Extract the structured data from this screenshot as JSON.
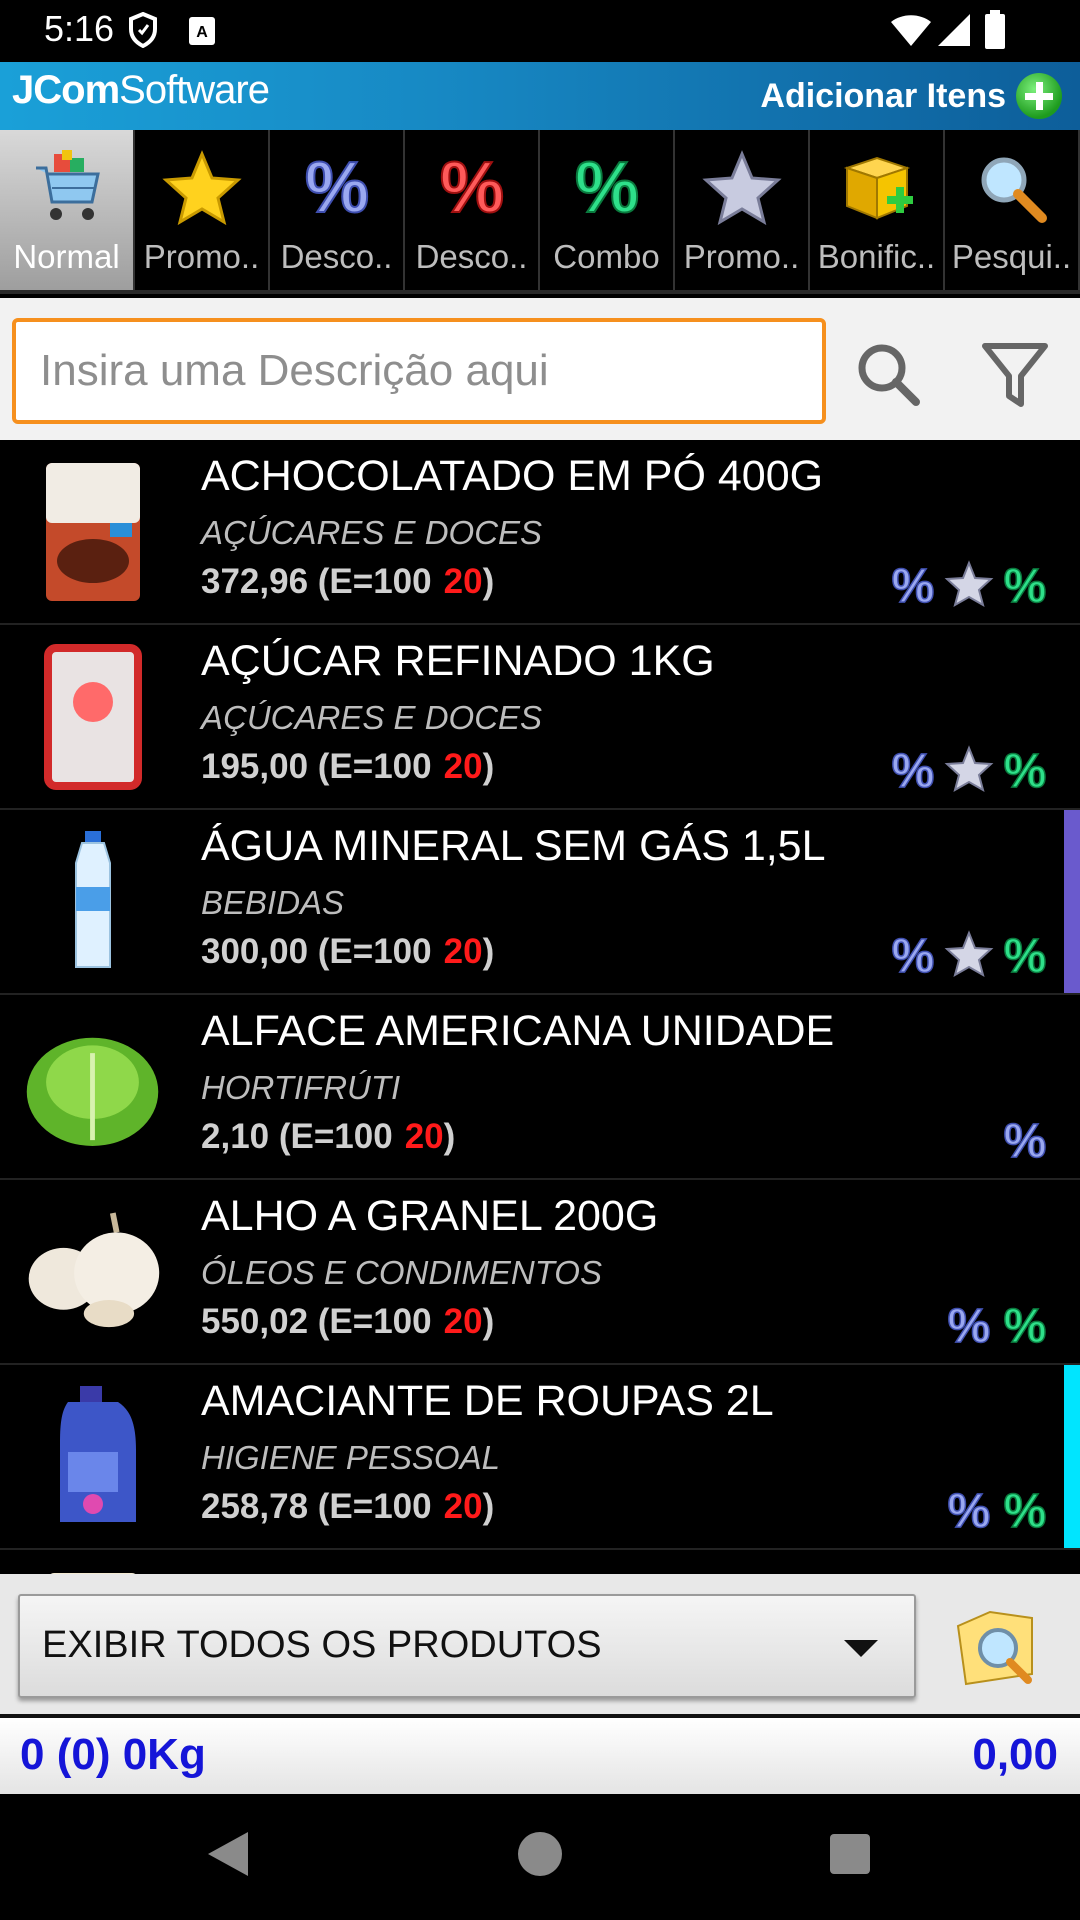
{
  "status_bar": {
    "time": "5:16"
  },
  "header": {
    "brand_bold": "JCom",
    "brand_light": "Software",
    "add_items_label": "Adicionar Itens"
  },
  "tabs": [
    {
      "label": "Normal",
      "icon": "cart-icon",
      "active": true
    },
    {
      "label": "Promo..",
      "icon": "gold-star-icon"
    },
    {
      "label": "Desco..",
      "icon": "blue-percent-icon"
    },
    {
      "label": "Desco..",
      "icon": "red-percent-icon"
    },
    {
      "label": "Combo",
      "icon": "green-percent-icon"
    },
    {
      "label": "Promo..",
      "icon": "silver-star-icon"
    },
    {
      "label": "Bonific..",
      "icon": "gift-box-icon"
    },
    {
      "label": "Pesqui..",
      "icon": "magnifier-icon"
    }
  ],
  "search": {
    "placeholder": "Insira uma Descrição aqui"
  },
  "products": [
    {
      "name": "ACHOCOLATADO EM PÓ 400G",
      "category": "AÇÚCARES E DOCES",
      "price": "372,96 (E=100",
      "stock": "20",
      "close": ")",
      "badges": [
        "blue-percent",
        "silver-star",
        "green-percent"
      ],
      "marker": ""
    },
    {
      "name": "AÇÚCAR REFINADO 1KG",
      "category": "AÇÚCARES E DOCES",
      "price": "195,00 (E=100",
      "stock": "20",
      "close": ")",
      "badges": [
        "blue-percent",
        "silver-star",
        "green-percent"
      ],
      "marker": ""
    },
    {
      "name": "ÁGUA MINERAL SEM GÁS 1,5L",
      "category": "BEBIDAS",
      "price": "300,00 (E=100",
      "stock": "20",
      "close": ")",
      "badges": [
        "blue-percent",
        "silver-star",
        "green-percent"
      ],
      "marker": "#6a5acd"
    },
    {
      "name": "ALFACE AMERICANA UNIDADE",
      "category": "HORTIFRÚTI",
      "price": "2,10 (E=100",
      "stock": "20",
      "close": ")",
      "badges": [
        "blue-percent"
      ],
      "marker": ""
    },
    {
      "name": "ALHO A GRANEL 200G",
      "category": "ÓLEOS E CONDIMENTOS",
      "price": "550,02 (E=100",
      "stock": "20",
      "close": ")",
      "badges": [
        "blue-percent",
        "green-percent"
      ],
      "marker": ""
    },
    {
      "name": "AMACIANTE DE ROUPAS 2L",
      "category": "HIGIENE PESSOAL",
      "price": "258,78 (E=100",
      "stock": "20",
      "close": ")",
      "badges": [
        "blue-percent",
        "green-percent"
      ],
      "marker": "#00e5ff"
    }
  ],
  "filter": {
    "selected": "EXIBIR TODOS OS PRODUTOS"
  },
  "totals": {
    "left": "0 (0) 0Kg",
    "right": "0,00"
  }
}
